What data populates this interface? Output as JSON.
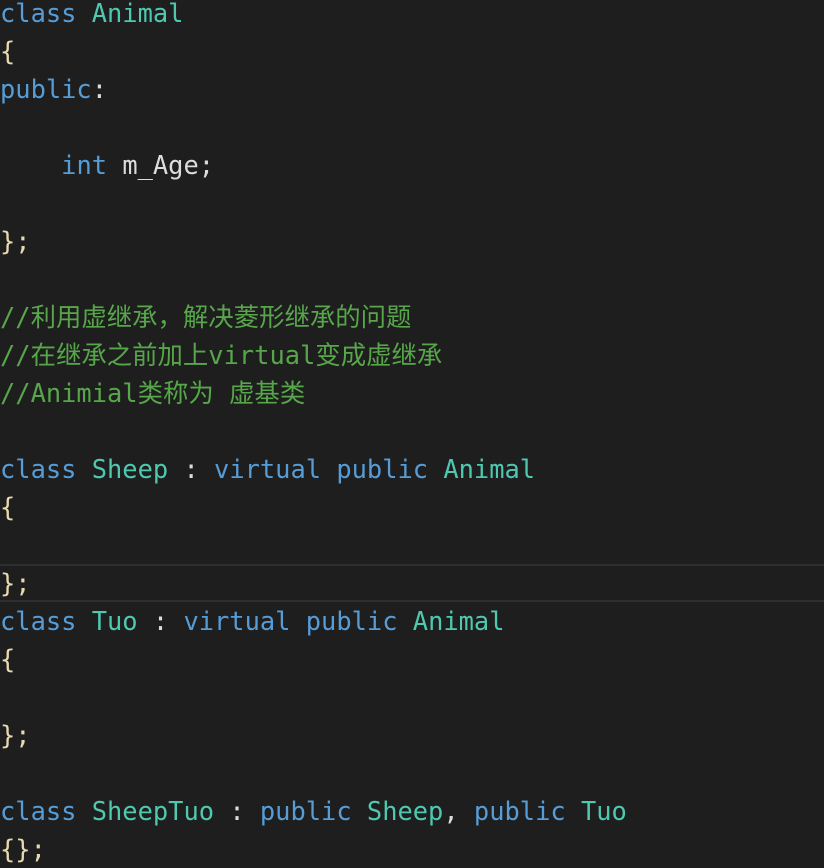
{
  "editor": {
    "current_line": 15,
    "lines": [
      [
        {
          "t": "class",
          "c": "kw"
        },
        {
          "t": " "
        },
        {
          "t": "Animal",
          "c": "type"
        }
      ],
      [
        {
          "t": "{",
          "c": "brace"
        }
      ],
      [
        {
          "t": "public",
          "c": "kw"
        },
        {
          "t": ":",
          "c": "pn"
        }
      ],
      [],
      [
        {
          "t": "    "
        },
        {
          "t": "int",
          "c": "kw"
        },
        {
          "t": " "
        },
        {
          "t": "m_Age",
          "c": "id"
        },
        {
          "t": ";",
          "c": "pn"
        }
      ],
      [],
      [
        {
          "t": "};",
          "c": "brace"
        }
      ],
      [],
      [
        {
          "t": "//利用虚继承，解决菱形继承的问题",
          "c": "cm"
        }
      ],
      [
        {
          "t": "//在继承之前加上virtual变成虚继承",
          "c": "cm"
        }
      ],
      [
        {
          "t": "//Animial类称为 虚基类",
          "c": "cm"
        }
      ],
      [],
      [
        {
          "t": "class",
          "c": "kw"
        },
        {
          "t": " "
        },
        {
          "t": "Sheep",
          "c": "type"
        },
        {
          "t": " : ",
          "c": "pn"
        },
        {
          "t": "virtual",
          "c": "kw"
        },
        {
          "t": " "
        },
        {
          "t": "public",
          "c": "kw"
        },
        {
          "t": " "
        },
        {
          "t": "Animal",
          "c": "type"
        }
      ],
      [
        {
          "t": "{",
          "c": "brace"
        }
      ],
      [],
      [
        {
          "t": "};",
          "c": "brace"
        }
      ],
      [
        {
          "t": "class",
          "c": "kw"
        },
        {
          "t": " "
        },
        {
          "t": "Tuo",
          "c": "type"
        },
        {
          "t": " : ",
          "c": "pn"
        },
        {
          "t": "virtual",
          "c": "kw"
        },
        {
          "t": " "
        },
        {
          "t": "public",
          "c": "kw"
        },
        {
          "t": " "
        },
        {
          "t": "Animal",
          "c": "type"
        }
      ],
      [
        {
          "t": "{",
          "c": "brace"
        }
      ],
      [],
      [
        {
          "t": "};",
          "c": "brace"
        }
      ],
      [],
      [
        {
          "t": "class",
          "c": "kw"
        },
        {
          "t": " "
        },
        {
          "t": "SheepTuo",
          "c": "type"
        },
        {
          "t": " : ",
          "c": "pn"
        },
        {
          "t": "public",
          "c": "kw"
        },
        {
          "t": " "
        },
        {
          "t": "Sheep",
          "c": "type"
        },
        {
          "t": ", ",
          "c": "pn"
        },
        {
          "t": "public",
          "c": "kw"
        },
        {
          "t": " "
        },
        {
          "t": "Tuo",
          "c": "type"
        }
      ],
      [
        {
          "t": "{};",
          "c": "brace"
        }
      ]
    ]
  }
}
